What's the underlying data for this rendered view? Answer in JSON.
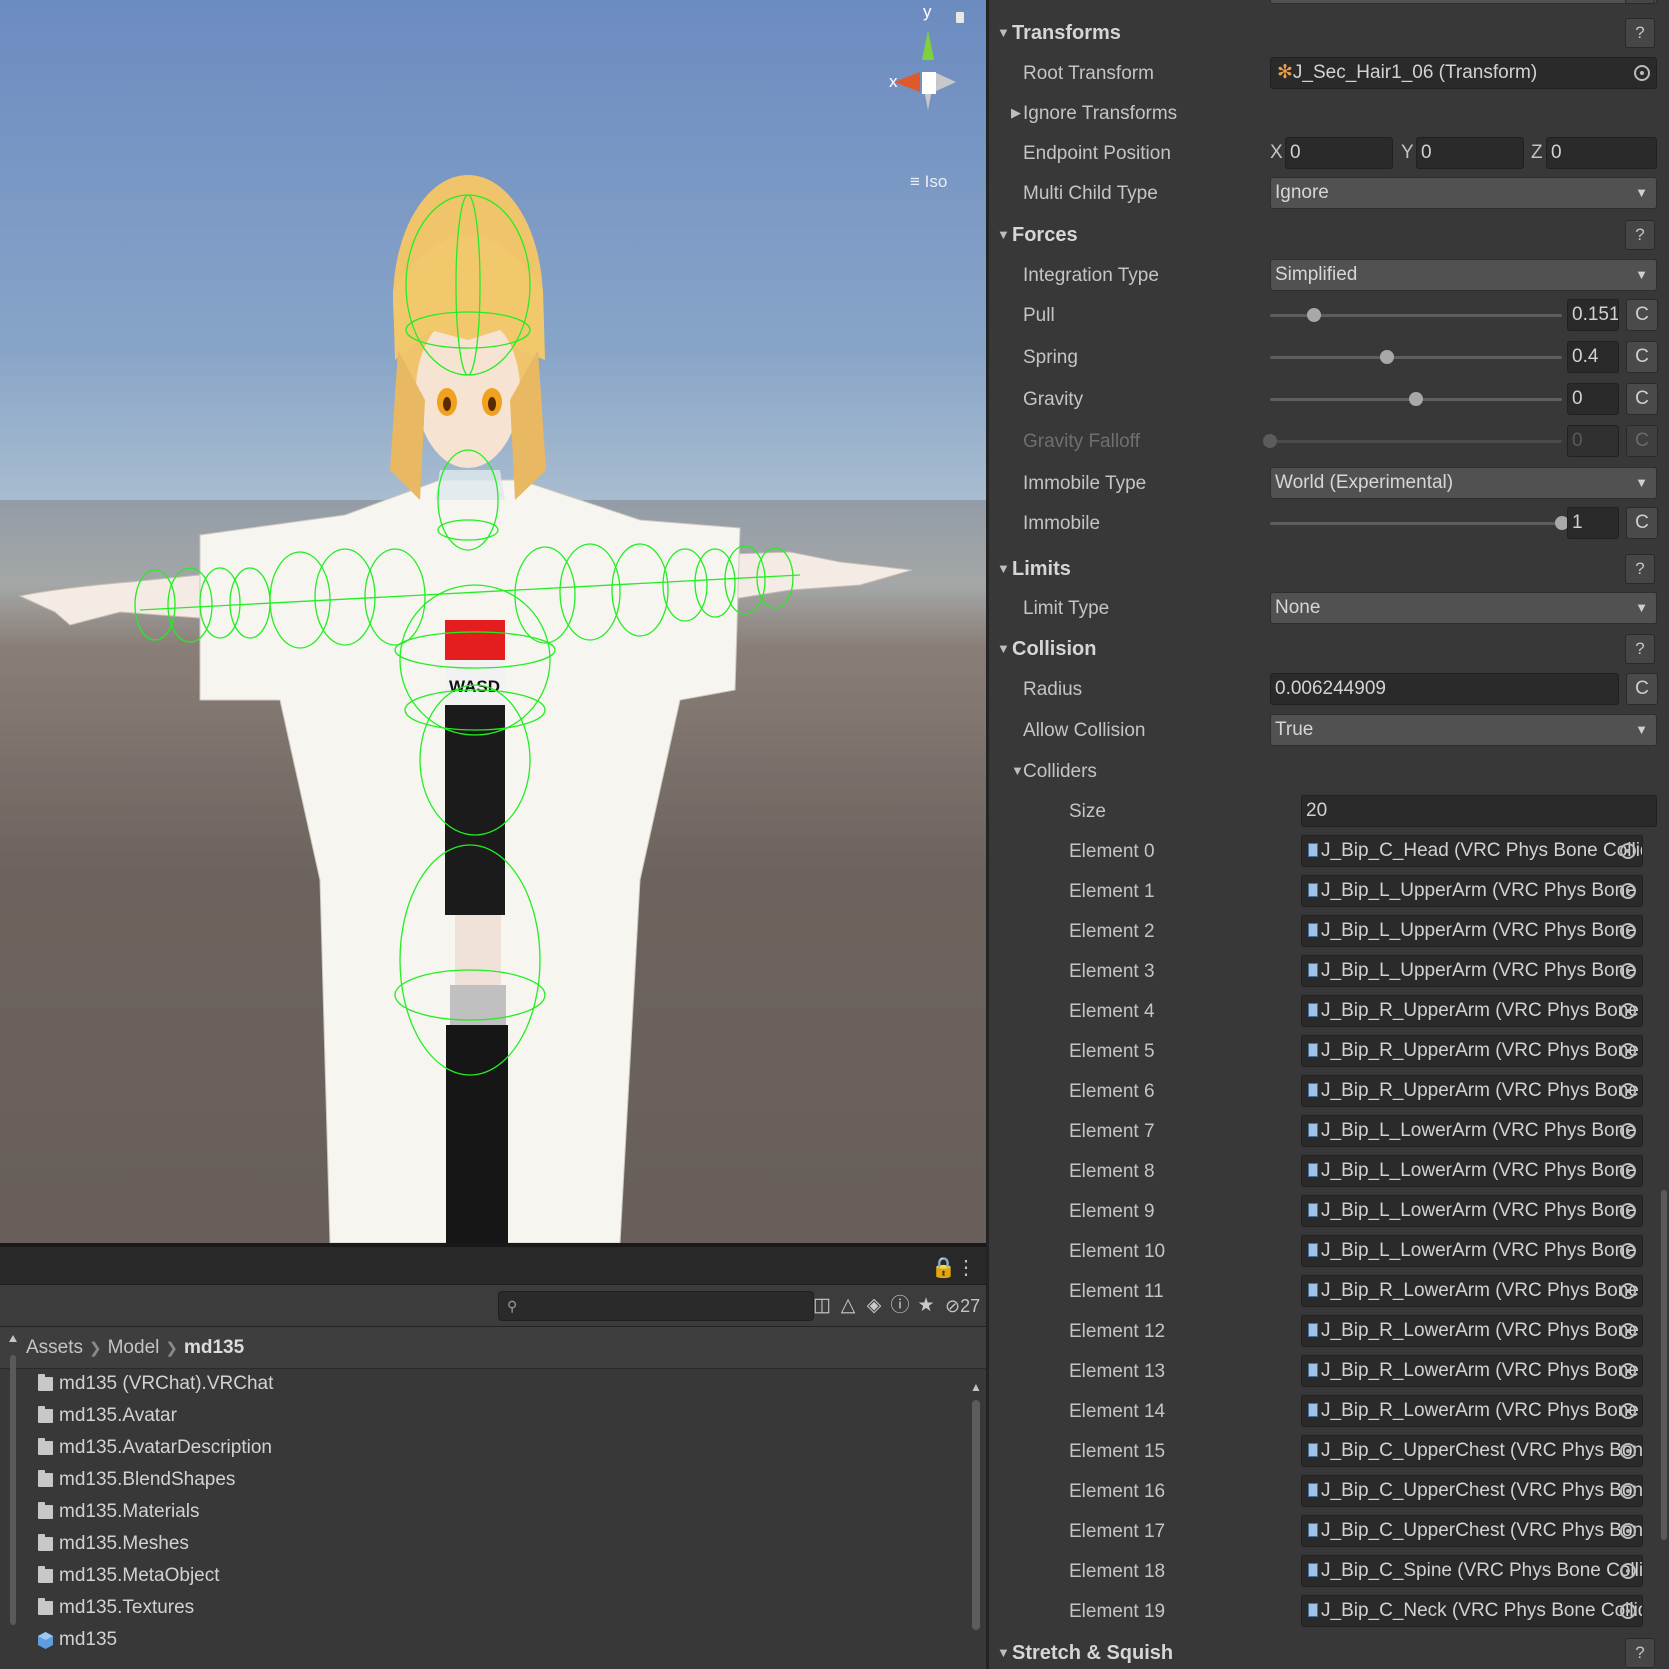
{
  "scene": {
    "gizmo": {
      "y_label": "y",
      "x_label": "x",
      "iso_label": "≡ Iso"
    },
    "figure_text": "WASD"
  },
  "project": {
    "search": {
      "placeholder": "",
      "value": ""
    },
    "hidden_count": "27",
    "breadcrumb": [
      "Assets",
      "Model",
      "md135"
    ],
    "items": [
      {
        "name": "md135 (VRChat).VRChat",
        "icon": "folder-icon"
      },
      {
        "name": "md135.Avatar",
        "icon": "folder-icon"
      },
      {
        "name": "md135.AvatarDescription",
        "icon": "folder-icon"
      },
      {
        "name": "md135.BlendShapes",
        "icon": "folder-icon"
      },
      {
        "name": "md135.Materials",
        "icon": "folder-icon"
      },
      {
        "name": "md135.Meshes",
        "icon": "folder-icon"
      },
      {
        "name": "md135.MetaObject",
        "icon": "folder-icon"
      },
      {
        "name": "md135.Textures",
        "icon": "folder-icon"
      },
      {
        "name": "md135",
        "icon": "prefab-icon"
      }
    ]
  },
  "inspector": {
    "transforms": {
      "title": "Transforms",
      "help": "?",
      "root_transform_label": "Root Transform",
      "root_transform_value": "J_Sec_Hair1_06 (Transform)",
      "ignore_transforms_label": "Ignore Transforms",
      "endpoint_label": "Endpoint Position",
      "endpoint": {
        "x_label": "X",
        "x": "0",
        "y_label": "Y",
        "y": "0",
        "z_label": "Z",
        "z": "0"
      },
      "multi_child_label": "Multi Child Type",
      "multi_child_value": "Ignore"
    },
    "forces": {
      "title": "Forces",
      "help": "?",
      "integration_label": "Integration Type",
      "integration_value": "Simplified",
      "pull_label": "Pull",
      "pull_value": "0.15104",
      "pull_fraction": 0.15104,
      "spring_label": "Spring",
      "spring_value": "0.4",
      "spring_fraction": 0.4,
      "gravity_label": "Gravity",
      "gravity_value": "0",
      "gravity_fraction": 0.5,
      "gravity_falloff_label": "Gravity Falloff",
      "gravity_falloff_value": "0",
      "gravity_falloff_fraction": 0,
      "immobile_type_label": "Immobile Type",
      "immobile_type_value": "World (Experimental)",
      "immobile_label": "Immobile",
      "immobile_value": "1",
      "immobile_fraction": 1,
      "curve_button": "C"
    },
    "limits": {
      "title": "Limits",
      "help": "?",
      "limit_type_label": "Limit Type",
      "limit_type_value": "None"
    },
    "collision": {
      "title": "Collision",
      "help": "?",
      "radius_label": "Radius",
      "radius_value": "0.006244909",
      "allow_collision_label": "Allow Collision",
      "allow_collision_value": "True",
      "colliders_label": "Colliders",
      "size_label": "Size",
      "size_value": "20",
      "elements": [
        {
          "label": "Element 0",
          "value": "J_Bip_C_Head (VRC Phys Bone Collider)"
        },
        {
          "label": "Element 1",
          "value": "J_Bip_L_UpperArm (VRC Phys Bone Collider)"
        },
        {
          "label": "Element 2",
          "value": "J_Bip_L_UpperArm (VRC Phys Bone Collider)"
        },
        {
          "label": "Element 3",
          "value": "J_Bip_L_UpperArm (VRC Phys Bone Collider)"
        },
        {
          "label": "Element 4",
          "value": "J_Bip_R_UpperArm (VRC Phys Bone Collider)"
        },
        {
          "label": "Element 5",
          "value": "J_Bip_R_UpperArm (VRC Phys Bone Collider)"
        },
        {
          "label": "Element 6",
          "value": "J_Bip_R_UpperArm (VRC Phys Bone Collider)"
        },
        {
          "label": "Element 7",
          "value": "J_Bip_L_LowerArm (VRC Phys Bone Collider)"
        },
        {
          "label": "Element 8",
          "value": "J_Bip_L_LowerArm (VRC Phys Bone Collider)"
        },
        {
          "label": "Element 9",
          "value": "J_Bip_L_LowerArm (VRC Phys Bone Collider)"
        },
        {
          "label": "Element 10",
          "value": "J_Bip_L_LowerArm (VRC Phys Bone Collider)"
        },
        {
          "label": "Element 11",
          "value": "J_Bip_R_LowerArm (VRC Phys Bone Collider)"
        },
        {
          "label": "Element 12",
          "value": "J_Bip_R_LowerArm (VRC Phys Bone Collider)"
        },
        {
          "label": "Element 13",
          "value": "J_Bip_R_LowerArm (VRC Phys Bone Collider)"
        },
        {
          "label": "Element 14",
          "value": "J_Bip_R_LowerArm (VRC Phys Bone Collider)"
        },
        {
          "label": "Element 15",
          "value": "J_Bip_C_UpperChest (VRC Phys Bone Collider)"
        },
        {
          "label": "Element 16",
          "value": "J_Bip_C_UpperChest (VRC Phys Bone Collider)"
        },
        {
          "label": "Element 17",
          "value": "J_Bip_C_UpperChest (VRC Phys Bone Collider)"
        },
        {
          "label": "Element 18",
          "value": "J_Bip_C_Spine (VRC Phys Bone Collider)"
        },
        {
          "label": "Element 19",
          "value": "J_Bip_C_Neck (VRC Phys Bone Collider)"
        }
      ]
    },
    "stretch": {
      "title": "Stretch & Squish",
      "help": "?"
    }
  },
  "colors": {
    "collider_gizmo": "#22ee22",
    "panel_bg": "#383838",
    "field_bg": "#2a2a2a"
  }
}
